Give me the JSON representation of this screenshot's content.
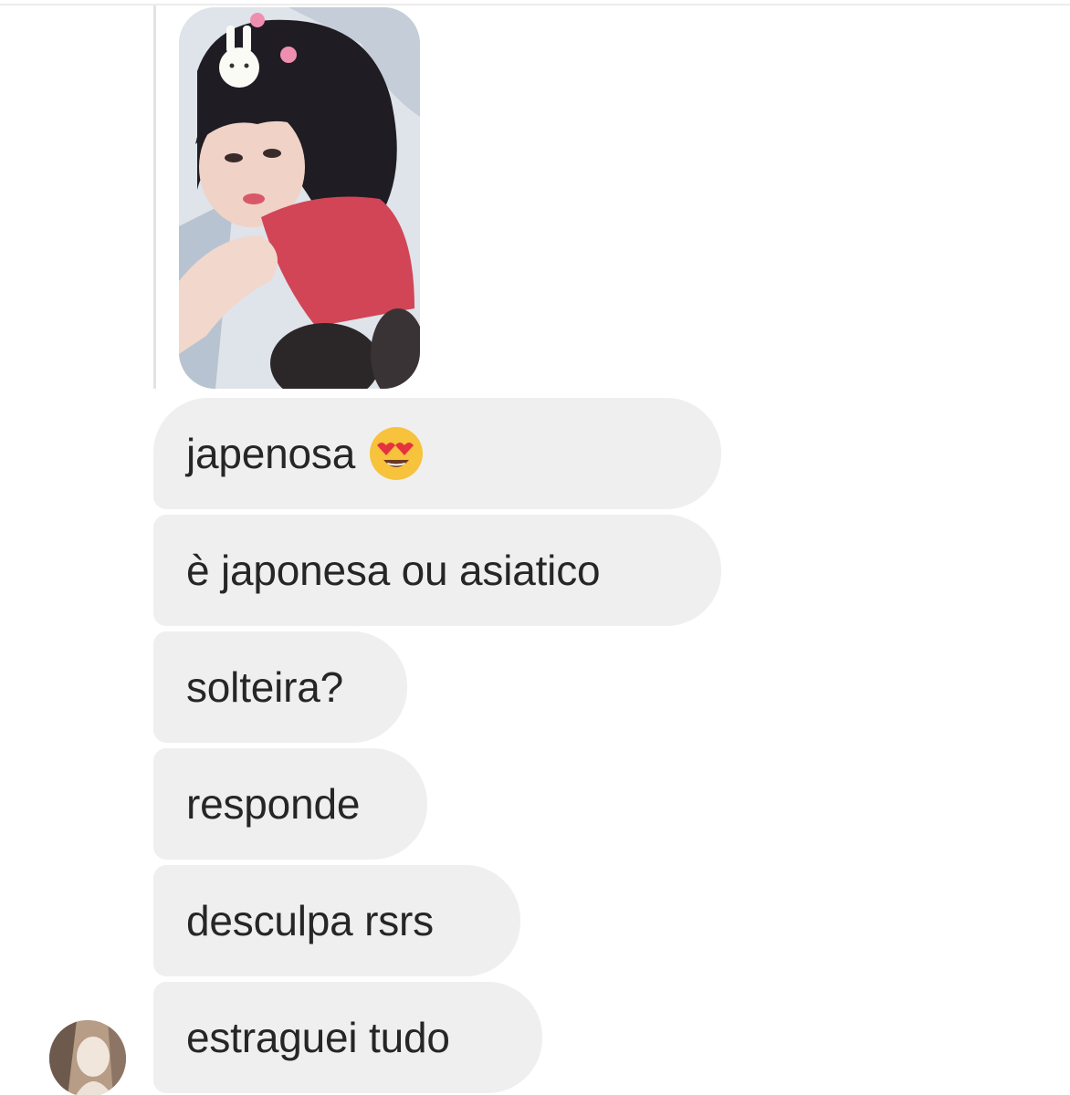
{
  "conversation": {
    "photo_icon": "shared-photo",
    "messages": [
      {
        "text": "japenosa",
        "emoji": "smiling-face-with-heart-eyes-icon"
      },
      {
        "text": "è japonesa ou asiatico"
      },
      {
        "text": "solteira?"
      },
      {
        "text": "responde"
      },
      {
        "text": "desculpa rsrs"
      },
      {
        "text": "estraguei tudo"
      }
    ],
    "sender_avatar_icon": "user-avatar",
    "colors": {
      "background": "#ffffff",
      "bubble": "#efefef",
      "text": "#262626"
    }
  }
}
